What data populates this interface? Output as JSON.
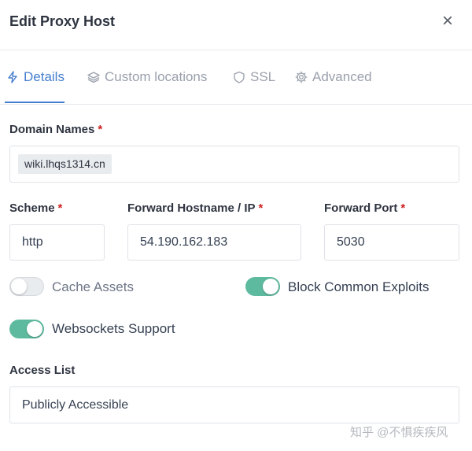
{
  "modal": {
    "title": "Edit Proxy Host",
    "close_label": "×"
  },
  "tabs": [
    {
      "label": "Details",
      "icon": "bolt-icon",
      "active": true
    },
    {
      "label": "Custom locations",
      "icon": "layers-icon",
      "active": false
    },
    {
      "label": "SSL",
      "icon": "shield-icon",
      "active": false
    },
    {
      "label": "Advanced",
      "icon": "gear-icon",
      "active": false
    }
  ],
  "domain_names": {
    "label": "Domain Names",
    "required_mark": "*",
    "chips": [
      "wiki.lhqs1314.cn"
    ]
  },
  "scheme": {
    "label": "Scheme",
    "required_mark": "*",
    "value": "http"
  },
  "forward_host": {
    "label": "Forward Hostname / IP",
    "required_mark": "*",
    "value": "54.190.162.183"
  },
  "forward_port": {
    "label": "Forward Port",
    "required_mark": "*",
    "value": "5030"
  },
  "toggles": {
    "cache_assets": {
      "label": "Cache Assets",
      "on": false
    },
    "block_exploits": {
      "label": "Block Common Exploits",
      "on": true
    },
    "websockets": {
      "label": "Websockets Support",
      "on": true
    }
  },
  "access_list": {
    "label": "Access List",
    "value": "Publicly Accessible"
  },
  "watermark": "知乎 @不惧疾疾风",
  "colors": {
    "accent": "#467fcf",
    "toggle_on": "#5eba9f",
    "required": "#cd201f"
  }
}
